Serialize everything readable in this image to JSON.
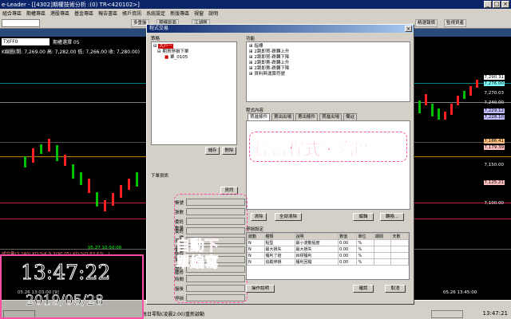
{
  "window": {
    "title": "e-Leader - [[4302]期權技術分析 :(0) TR<420102>]"
  },
  "menu": [
    "組合專區",
    "期權專區",
    "港股專區",
    "基金專區",
    "報告書區",
    "帳戶資訊",
    "系統設定",
    "新版專區",
    "視窗",
    "說明"
  ],
  "toolbar": {
    "buttons": [
      "多重盤",
      "期權版面",
      "江湖圖",
      "精選報價",
      "監視資產",
      "新聞",
      "圖表"
    ]
  },
  "symbol": {
    "code": "TXFF0",
    "period": "期權選擇  05"
  },
  "chart": {
    "kbar_caption": "K線圖(開: 7,269.00 高: 7,282.00 低: 7,266.00 收: 7,280.00)",
    "indicator_caption": "成交量(3,240)  KD:%K:9.3(90.05)  KD:%D:83.63(...)",
    "left_time": "05.26  13:03:00 [9]",
    "right_time": "05.26  13:45:00",
    "marker_text": "05.27  10:50:00",
    "prices": [
      "7,290.31",
      "7,276.00",
      "7,270.03",
      "7,240.00",
      "7,229.12",
      "7,228.10",
      "7,186.41",
      "7,179.39",
      "7,150.00",
      "7,125.21",
      "7,100.00"
    ]
  },
  "overlay": {
    "time": "13:47:22",
    "date": "2019/05/28"
  },
  "status": {
    "clock": "13:47:21",
    "left": "每日零點(凌晨2:00)重新啟動",
    "timer": "13:47:21"
  },
  "dialog": {
    "title": "程式交易",
    "strategy_label": "策略",
    "tree": [
      "大戶一",
      "期貨停損下單",
      "單_0105"
    ],
    "save_btn": "儲存",
    "delete_btn": "刪除",
    "function_label": "功能",
    "functions": [
      "指標",
      "2跳即買-跌轉上升",
      "2跳即買-跌轉下降",
      "2跳即賣-跌轉上升",
      "2跳即賣-跌轉下降",
      "資料與運算符號"
    ],
    "code_label": "程式內容",
    "code_tabs": [
      "買進條件",
      "賣出出場",
      "賣出條件",
      "買進出場",
      "備註"
    ],
    "code_annotation": "操盤程式編寫區",
    "clear_btn": "清除",
    "clear_all_btn": "全部清除",
    "edit_btn": "編輯",
    "convert_btn": "轉換...",
    "order_label": "下單資訊",
    "info_btn": "資訊",
    "order_fields": [
      "帳號",
      "張數",
      "委託數量",
      "委託價",
      "買進出場條件",
      "賣出出場",
      "賣出出場條件",
      "部位",
      "時間",
      "盤後",
      "停損"
    ],
    "order_annotation_1": "自動下",
    "order_annotation_2": "單編寫",
    "setting_label": "停損設定",
    "grid_headers": [
      "啟動",
      "種類",
      "說明",
      "數值",
      "單位",
      "期間",
      "天數"
    ],
    "grid_rows": [
      [
        "N",
        "點型",
        "最小波動幅度",
        "0.00",
        "%",
        "",
        ""
      ],
      [
        "N",
        "最大損失",
        "最大損失",
        "0.00",
        "%",
        "",
        ""
      ],
      [
        "N",
        "獲利了結",
        "目標獲利",
        "0.00",
        "%",
        "",
        ""
      ],
      [
        "N",
        "追蹤停損",
        "獲利回檔",
        "0.00",
        "%",
        "",
        ""
      ]
    ],
    "help_btn": "操作說明",
    "ok_btn": "確認",
    "cancel_btn": "取消"
  }
}
